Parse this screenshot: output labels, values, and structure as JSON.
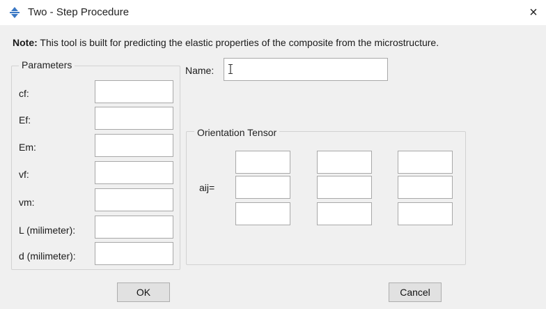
{
  "window": {
    "title": "Two - Step Procedure",
    "close_glyph": "×",
    "app_icon": "abaqus-plugin-icon"
  },
  "note": {
    "bold_prefix": "Note:",
    "text": " This tool is built for predicting the elastic properties of the composite from the microstructure."
  },
  "parameters": {
    "title": "Parameters",
    "fields": [
      {
        "label": "cf:",
        "value": ""
      },
      {
        "label": "Ef:",
        "value": ""
      },
      {
        "label": "Em:",
        "value": ""
      },
      {
        "label": "vf:",
        "value": ""
      },
      {
        "label": "vm:",
        "value": ""
      },
      {
        "label": "L (milimeter):",
        "value": ""
      },
      {
        "label": "d (milimeter):",
        "value": ""
      }
    ]
  },
  "name_field": {
    "label": "Name:",
    "value": ""
  },
  "orientation": {
    "title": "Orientation Tensor",
    "label": "aij=",
    "cells": [
      "",
      "",
      "",
      "",
      "",
      "",
      "",
      "",
      ""
    ]
  },
  "buttons": {
    "ok": "OK",
    "cancel": "Cancel"
  }
}
